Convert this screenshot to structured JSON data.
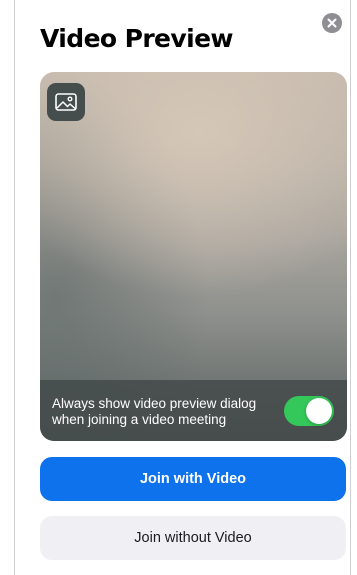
{
  "dialog": {
    "title": "Video Preview"
  },
  "preview": {
    "background_icon": "image-icon",
    "toggle": {
      "line1": "Always show video preview dialog",
      "line2": "when joining a video meeting",
      "on": true,
      "color": "#34c759"
    }
  },
  "buttons": {
    "join_with_video": "Join with Video",
    "join_without_video": "Join without Video"
  },
  "colors": {
    "primary": "#0e72ed",
    "secondary_bg": "#efeff4",
    "close_bg": "#8e8e93"
  }
}
